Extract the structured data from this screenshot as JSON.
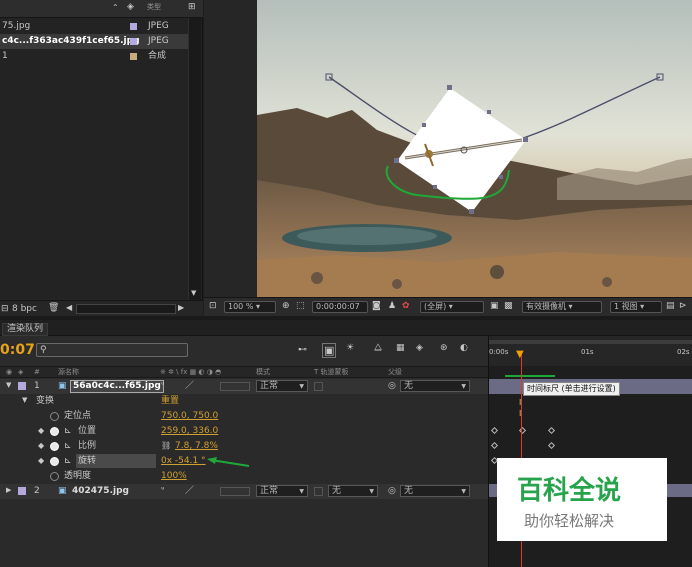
{
  "project": {
    "header_type_label": "类型",
    "items": [
      {
        "name": "75.jpg",
        "type": "JPEG",
        "color": "#b5a8dc"
      },
      {
        "name": "c4c...f363ac439f1cef65.jpg",
        "type": "JPEG",
        "color": "#b5a8dc"
      },
      {
        "name": "1",
        "type": "合成",
        "color": "#c4ac7b"
      }
    ],
    "bpc": "8 bpc"
  },
  "viewer": {
    "zoom": "100 %",
    "timecode": "0:00:00:07",
    "resolution": "(全屏)",
    "camera": "有效摄像机",
    "views": "1 视图"
  },
  "timeline": {
    "tab_label": "渲染队列",
    "current_time": "0:07",
    "search_placeholder": "",
    "col_headers": {
      "num": "#",
      "source_name": "源名称",
      "switches": "※ ✲ \\ fx ▦ ◐ ◑ ◓",
      "mode": "模式",
      "trkmat": "T  轨道蒙板",
      "parent": "父级"
    },
    "layer1": {
      "index": "1",
      "name": "56a0c4c...f65.jpg",
      "mode": "正常",
      "parent": "无"
    },
    "transform": {
      "label": "变换",
      "reset": "重置"
    },
    "props": [
      {
        "name": "定位点",
        "value": "750.0, 750.0"
      },
      {
        "name": "位置",
        "value": "259.0, 336.0"
      },
      {
        "name": "比例",
        "value": "7.8, 7.8%"
      },
      {
        "name": "旋转",
        "value": "0x -54.1 °"
      },
      {
        "name": "透明度",
        "value": "100%"
      }
    ],
    "layer2": {
      "index": "2",
      "name": "402475.jpg",
      "mode": "正常",
      "trkmat": "无",
      "parent": "无"
    },
    "ruler": {
      "t0": "0:00s",
      "t1": "01s",
      "t2": "02s"
    },
    "tooltip": "时间标尺 (单击进行设置)"
  },
  "watermark": {
    "title": "百科全说",
    "subtitle": "助你轻松解决"
  },
  "colors": {
    "bar": "#6b6b86",
    "accent": "#f0a000",
    "cti": "#d63c2a",
    "annotation": "#1fa838"
  }
}
